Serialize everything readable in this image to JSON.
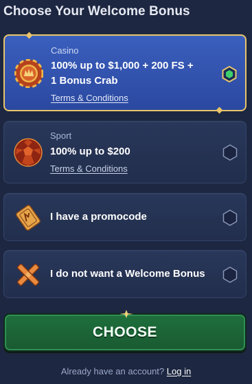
{
  "title": "Choose Your Welcome Bonus",
  "options": [
    {
      "category": "Casino",
      "headline_line1": "100% up to $1,000 + 200 FS +",
      "headline_line2": "1 Bonus Crab",
      "terms": "Terms & Conditions",
      "selected": true,
      "icon": "casino-chip-icon"
    },
    {
      "category": "Sport",
      "headline_line1": "100% up to $200",
      "terms": "Terms & Conditions",
      "selected": false,
      "icon": "soccer-ball-icon"
    },
    {
      "headline_line1": "I have a promocode",
      "selected": false,
      "icon": "ticket-icon"
    },
    {
      "headline_line1": "I do not want a Welcome Bonus",
      "selected": false,
      "icon": "cross-icon"
    }
  ],
  "choose_button": "CHOOSE",
  "footer": {
    "text": "Already have an account?",
    "link": "Log in"
  },
  "colors": {
    "background": "#1d2741",
    "selected_card": "#3a5fbd",
    "selected_border": "#e9c46a",
    "radio_selected": "#3ecf6b",
    "button_green": "#1e6f3c"
  }
}
